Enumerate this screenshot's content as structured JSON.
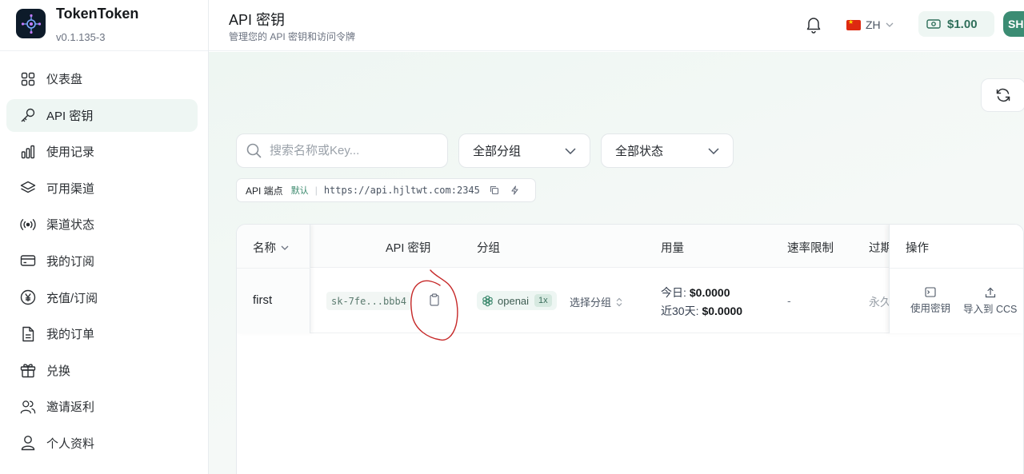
{
  "app": {
    "name": "TokenToken",
    "version": "v0.1.135-3"
  },
  "sidebar": {
    "items": [
      {
        "label": "仪表盘",
        "icon": "dashboard-icon"
      },
      {
        "label": "API 密钥",
        "icon": "key-icon",
        "active": true
      },
      {
        "label": "使用记录",
        "icon": "bar-chart-icon"
      },
      {
        "label": "可用渠道",
        "icon": "layers-icon"
      },
      {
        "label": "渠道状态",
        "icon": "broadcast-icon"
      },
      {
        "label": "我的订阅",
        "icon": "credit-card-icon"
      },
      {
        "label": "充值/订阅",
        "icon": "yen-circle-icon"
      },
      {
        "label": "我的订单",
        "icon": "document-icon"
      },
      {
        "label": "兑换",
        "icon": "gift-icon"
      },
      {
        "label": "邀请返利",
        "icon": "users-icon"
      },
      {
        "label": "个人资料",
        "icon": "user-icon"
      }
    ]
  },
  "header": {
    "title": "API 密钥",
    "subtitle": "管理您的 API 密钥和访问令牌",
    "language": "ZH",
    "balance": "$1.00",
    "avatar": "SH"
  },
  "filters": {
    "search_placeholder": "搜索名称或Key...",
    "group_select": "全部分组",
    "status_select": "全部状态"
  },
  "endpoint": {
    "label": "API 端点",
    "default_tag": "默认",
    "url": "https://api.hjltwt.com:2345"
  },
  "table": {
    "headers": {
      "name": "名称",
      "key": "API 密钥",
      "group": "分组",
      "usage": "用量",
      "rate": "速率限制",
      "expire": "过期",
      "actions": "操作"
    },
    "rows": [
      {
        "name": "first",
        "key": "sk-7fe...bbb4",
        "group": "openai",
        "multiplier": "1x",
        "pick_group": "选择分组",
        "usage_today_label": "今日:",
        "usage_today": "$0.0000",
        "usage_30d_label": "近30天:",
        "usage_30d": "$0.0000",
        "rate": "-",
        "expire": "永久",
        "action_use": "使用密钥",
        "action_import": "导入到 CCS"
      }
    ]
  },
  "colors": {
    "accent": "#3b8c73",
    "annotation": "#c62828"
  }
}
